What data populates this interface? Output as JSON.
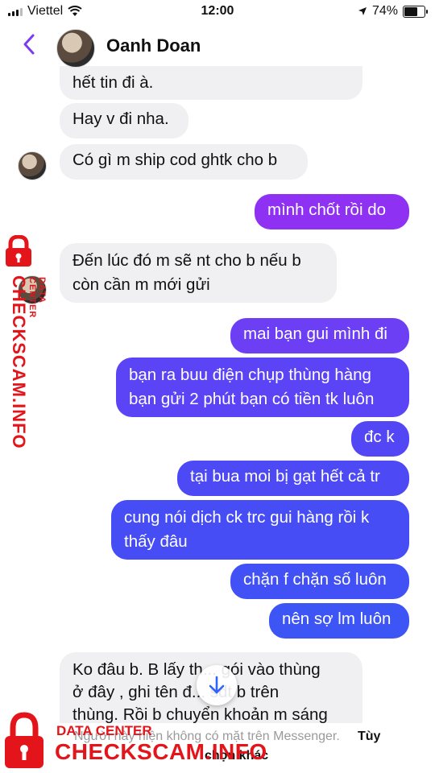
{
  "status_bar": {
    "carrier": "Viettel",
    "time": "12:00",
    "battery": "74%",
    "battery_level": 0.74
  },
  "header": {
    "contact_name": "Oanh Doan"
  },
  "messages": [
    {
      "id": 0,
      "side": "in",
      "lines": [
        "hết tin đi à."
      ]
    },
    {
      "id": 1,
      "side": "in",
      "lines": [
        "Hay v đi nha."
      ]
    },
    {
      "id": 2,
      "side": "in",
      "lines": [
        "Có gì m ship cod ghtk cho b"
      ]
    },
    {
      "id": 3,
      "side": "out",
      "lines": [
        "mình chốt rồi do"
      ]
    },
    {
      "id": 4,
      "side": "in",
      "lines": [
        "Đến lúc đó m sẽ nt cho b nếu b",
        "còn cần m mới gửi"
      ]
    },
    {
      "id": 5,
      "side": "out",
      "lines": [
        "mai bạn gui mình đi"
      ]
    },
    {
      "id": 6,
      "side": "out",
      "lines": [
        "bạn ra buu điện chụp thùng hàng",
        "bạn gửi 2 phút bạn có tiền tk luôn"
      ]
    },
    {
      "id": 7,
      "side": "out",
      "lines": [
        "đc k"
      ]
    },
    {
      "id": 8,
      "side": "out",
      "lines": [
        "tại bua moi bị gạt hết cả tr"
      ]
    },
    {
      "id": 9,
      "side": "out",
      "lines": [
        "cung nói dịch ck trc gui hàng rồi k",
        "thấy đâu"
      ]
    },
    {
      "id": 10,
      "side": "out",
      "lines": [
        "chặn f chặn số luôn"
      ]
    },
    {
      "id": 11,
      "side": "out",
      "lines": [
        "nên sợ lm luôn"
      ]
    },
    {
      "id": 12,
      "side": "in",
      "lines": [
        "Ko đâu b. B lấy th... gói vào thùng",
        "ở đây , ghi tên đ... sdt b trên",
        "thùng. Rồi b chuyển khoản m sáng"
      ]
    }
  ],
  "footer": {
    "notice": "Người này hiện không có mặt trên Messenger.",
    "action_line1": "Tùy",
    "action_line2": "chọn khác"
  },
  "watermark": {
    "sub": "DATA CENTER",
    "main": "CHECKSCAM.INFO"
  },
  "colors": {
    "outgoing_top": "#9c2cf3",
    "outgoing_bottom": "#3d55f5",
    "incoming": "#f0f0f2",
    "brand_red": "#e3151b",
    "back_arrow": "#7a3cf0"
  },
  "icons": [
    "back-chevron-icon",
    "wifi-icon",
    "location-arrow-icon",
    "battery-icon",
    "scroll-down-arrow-icon",
    "lock-icon"
  ]
}
